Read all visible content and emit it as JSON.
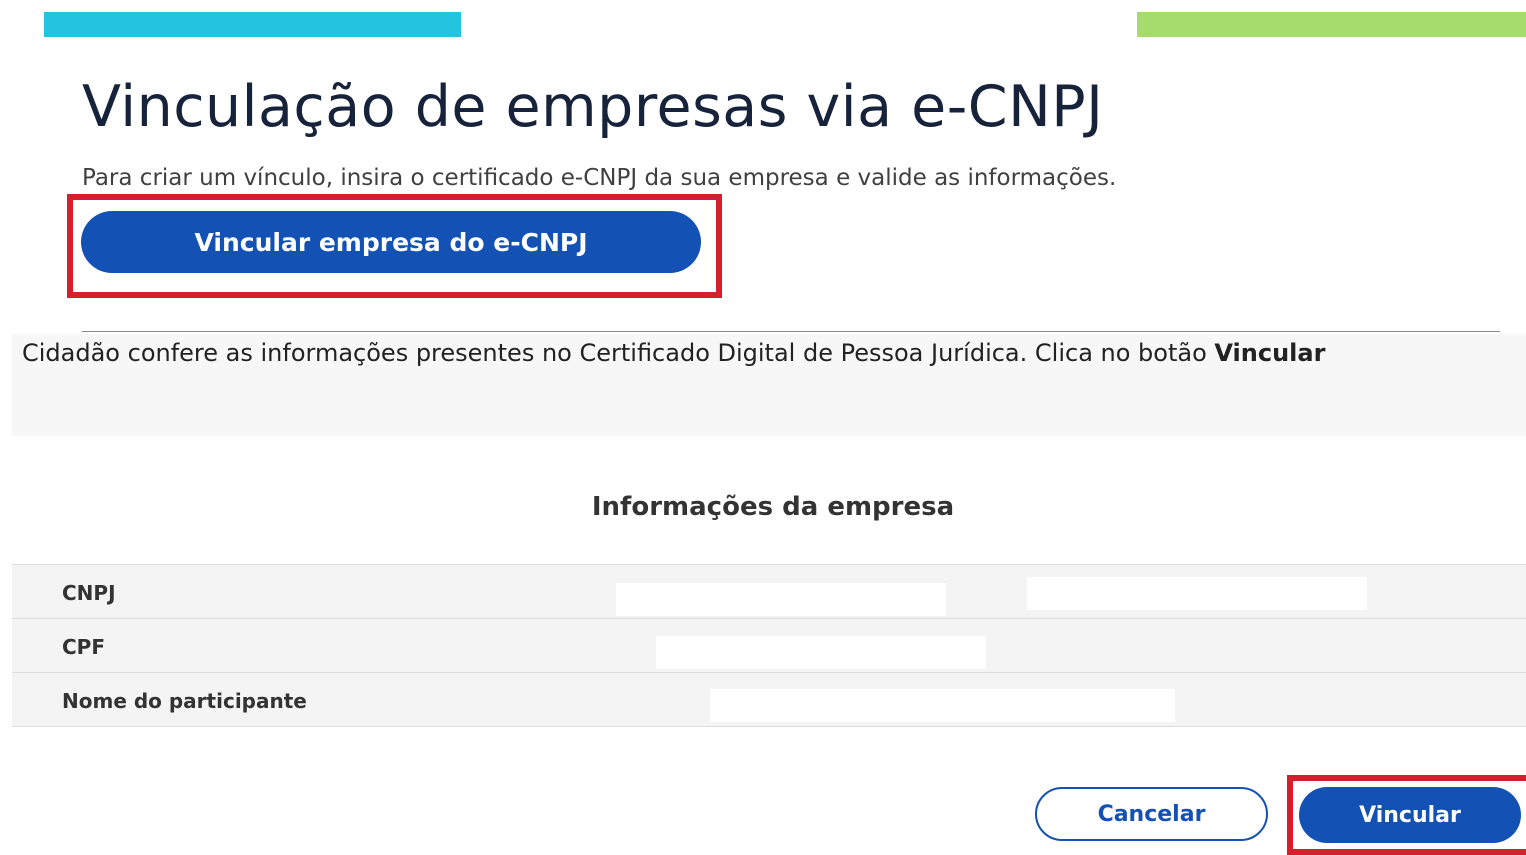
{
  "colors": {
    "bar_left": "#22c4e0",
    "bar_right": "#a6dc6e",
    "primary_blue": "#1351b4",
    "highlight_red": "#d4202c"
  },
  "header": {
    "title": "Vinculação de empresas via e-CNPJ",
    "subtitle": "Para criar um vínculo, insira o certificado e-CNPJ da sua empresa e valide as informações.",
    "link_button_label": "Vincular empresa do e-CNPJ"
  },
  "caption": {
    "text": "Cidadão confere as informações presentes no Certificado Digital de Pessoa Jurídica. Clica no botão ",
    "bold": "Vincular"
  },
  "company_info": {
    "heading": "Informações da empresa",
    "rows": [
      {
        "label": "CNPJ"
      },
      {
        "label": "CPF"
      },
      {
        "label": "Nome do participante"
      }
    ]
  },
  "actions": {
    "cancel_label": "Cancelar",
    "confirm_label": "Vincular"
  }
}
